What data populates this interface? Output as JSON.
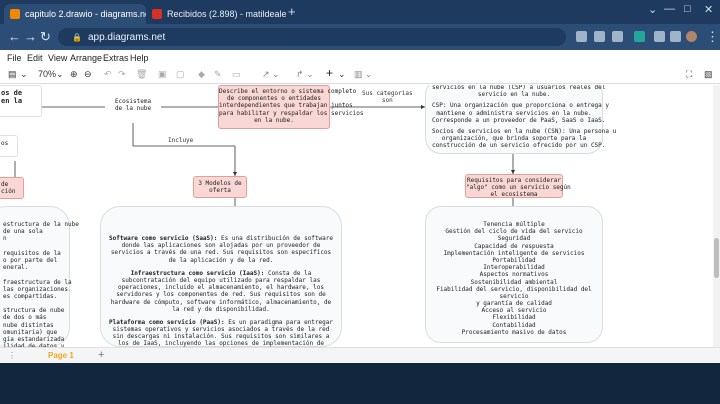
{
  "browser": {
    "tabs": [
      {
        "title": "capitulo 2.drawio - diagrams.net",
        "active": true
      },
      {
        "title": "Recibidos (2.898) - matildealexan",
        "active": false
      }
    ],
    "url": "app.diagrams.net"
  },
  "menu": [
    "File",
    "Edit",
    "View",
    "Arrange",
    "Extras",
    "Help"
  ],
  "toolbar": {
    "zoom": "70%"
  },
  "diagram": {
    "left_title_frag": "os de\nen la",
    "ecosistema": "Ecosistema\nde la nube",
    "describe": "Describe el entorno o sistema completo\nde componentes o entidades\ninterdependientes que trabajan juntos\npara habilitar y respaldar los servicios\nen la nube.",
    "sus_categorias": "Sus categorias\nson",
    "incluye": "Incluye",
    "left_os_frag": "os",
    "left_de_frag": "de\nción",
    "tres_modelos": "3 Modelos de\noferta",
    "csp_top": "servicios en la nube (CSP) a usuarios reales del\nservicio en la nube.",
    "csp_def": "CSP: Una organización que proporciona o entrega y\nmantiene o administra servicios en la nube.\nCorresponde a un proveedor de PaaS, SaaS o IaaS.",
    "csn_def": "Socios de servicios en la nube (CSN): Una persona u\norganización, que brinda soporte para la\nconstrucción de un servicio ofrecido por un CSP.",
    "requisitos_title": "Requisitos para considerar\n\"algo\" como un servicio según\nel ecosistema",
    "requisitos": [
      "Tenencia múltiple",
      "Gestión del ciclo de vida del servicio",
      "Seguridad",
      "Capacidad de respuesta",
      "Implementación inteligente de servicios",
      "Portabilidad",
      "Interoperabilidad",
      "Aspectos normativos",
      "Sostenibilidad ambiental",
      "Fiabilidad del servicio, disponibilidad del servicio",
      "y garantía de calidad",
      "Acceso al servicio",
      "Flexibilidad",
      "Contabilidad",
      "Procesamiento masivo de datos"
    ],
    "saas_head": "Software como servicio (SaaS):",
    "saas_body": " Es una distribución de software donde las aplicaciones son alojadas por un proveedor de servicios a través de una red. Sus requisitos son específicos de la aplicación y de la red.",
    "iaas_head": "Infraestructura como servicio (IaaS):",
    "iaas_body": " Consta de la subcontratación del equipo utilizado para respaldar las operaciones, incluido el almacenamiento, el hardware, los servidores y los componentes de red. Sus requisitos son de hardware de cómputo, software informático, almacenamiento, de la red y de disponibilidad.",
    "paas_head": "Plataforma como servicio (PaaS):",
    "paas_body": " Es un paradigma para entregar sistemas operativos y servicios asociados a través de la red sin descargas ni instalación. Sus requisitos son similares a los de IaaS, incluyendo las opciones de implementación de aplicaciones creadas por el usuario.",
    "left_frag_text": "estructura de la nube\nde una sola\nn\n\nrequisitos de la\no por parte del\neneral.\n\nfraestructura de la\nlas organizaciones\nes compartidas.\n\nstructura de nube\nde dos o más\nnube distintas\nomunitaria) que\ngía estandarizada\nilidad de datos y\nembargo, cada\nsiendo autónoma."
  },
  "pages": {
    "page_label": "Page 1",
    "add": "+"
  }
}
